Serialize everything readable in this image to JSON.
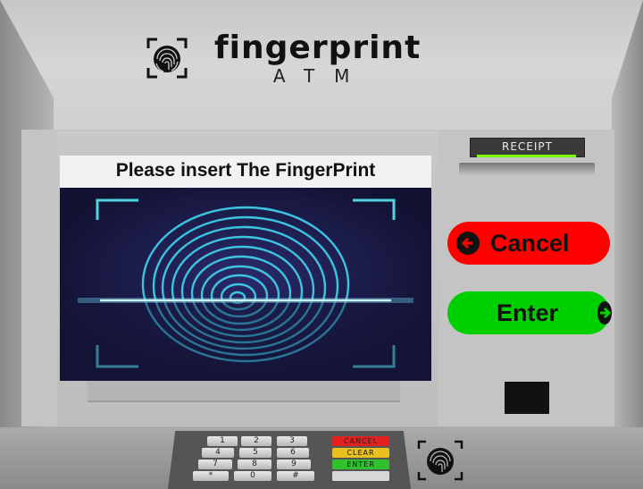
{
  "brand": {
    "title": "fingerprint",
    "subtitle": "ATM"
  },
  "screen": {
    "prompt": "Please insert The FingerPrint"
  },
  "receipt": {
    "label": "RECEIPT"
  },
  "buttons": {
    "cancel": "Cancel",
    "enter": "Enter"
  },
  "keypad": {
    "keys": [
      "1",
      "2",
      "3",
      "4",
      "5",
      "6",
      "7",
      "8",
      "9",
      "*",
      "0",
      "#"
    ],
    "function_keys": [
      "CANCEL",
      "CLEAR",
      "ENTER",
      ""
    ]
  },
  "colors": {
    "cancel": "#ff0000",
    "enter": "#00d000",
    "screen_bg": "#16163a",
    "fingerprint": "#3fd6f0"
  },
  "icons": [
    "fingerprint-logo-icon",
    "arrow-left-icon",
    "arrow-right-icon",
    "fingerprint-scanner-icon"
  ]
}
